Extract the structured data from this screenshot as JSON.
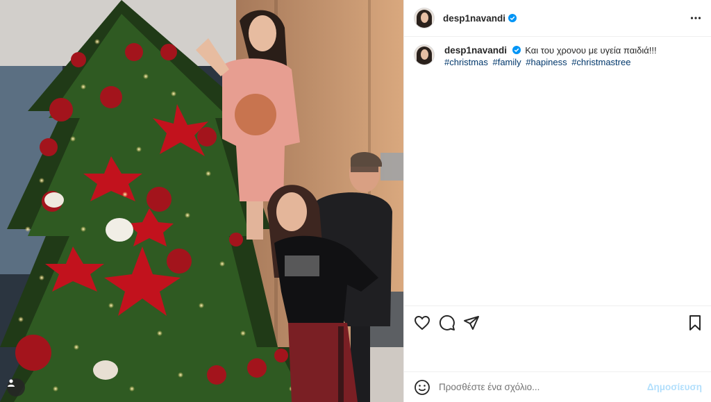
{
  "post": {
    "username": "desp1navandi",
    "verified": true,
    "more_icon": "more-horizontal-icon",
    "caption": {
      "text": "Και του χρονου με υγεία παιδιά!!!",
      "hashtags": [
        "#christmas",
        "#family",
        "#hapiness",
        "#christmastree"
      ]
    },
    "actions": {
      "like_icon": "heart-icon",
      "comment_icon": "comment-icon",
      "share_icon": "paper-plane-icon",
      "save_icon": "bookmark-icon"
    },
    "comment_box": {
      "emoji_icon": "smiley-icon",
      "placeholder": "Προσθέστε ένα σχόλιο...",
      "publish_label": "Δημοσίευση"
    },
    "media": {
      "user_tag_icon": "person-tag-icon"
    }
  },
  "colors": {
    "verified_blue": "#0095f6",
    "hashtag_link": "#00376b",
    "publish_disabled": "#b2dffc"
  }
}
